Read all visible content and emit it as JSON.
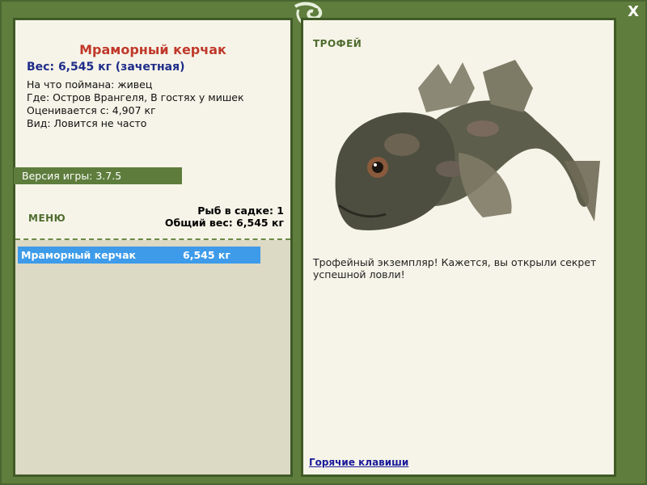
{
  "window": {
    "close_label": "X"
  },
  "catch": {
    "fish_name": "Мраморный керчак",
    "weight_line": "Вес: 6,545 кг (зачетная)",
    "details": [
      "На что поймана: живец",
      "Где: Остров Врангеля, В гостях у мишек",
      "Оценивается с: 4,907 кг",
      "Вид: Ловится не часто"
    ]
  },
  "version": {
    "label": "Версия игры: 3.7.5"
  },
  "menu": {
    "label": "МЕНЮ"
  },
  "keepnet": {
    "count_line": "Рыб в садке: 1",
    "total_line": "Общий вес: 6,545 кг",
    "items": [
      {
        "name": "Мраморный керчак",
        "weight": "6,545 кг"
      }
    ]
  },
  "trophy": {
    "label": "ТРОФЕЙ",
    "description": "Трофейный экземпляр! Кажется, вы открыли секрет успешной ловли!",
    "hotkeys_link": "Горячие клавиши"
  },
  "colors": {
    "frame": "#5f7d3c",
    "panel": "#f6f4e8",
    "title_red": "#c0392b",
    "weight_blue": "#1f2d8a",
    "selected_row": "#3d9be9"
  },
  "icons": {
    "close": "close-icon",
    "logo": "lizard-icon",
    "fish": "sculpin-fish-image"
  }
}
